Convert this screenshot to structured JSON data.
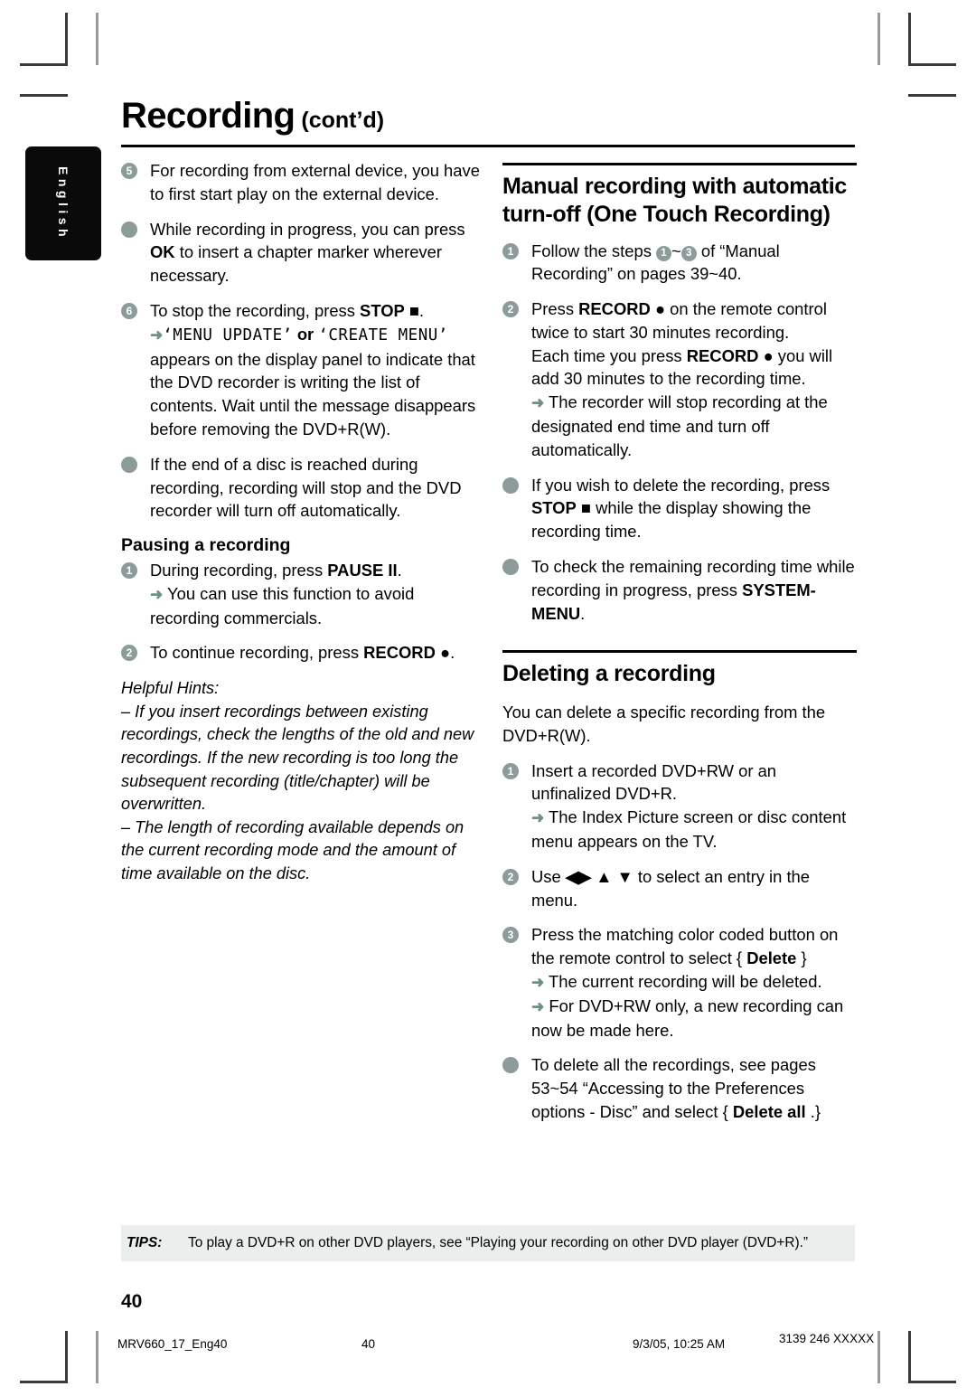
{
  "language_tab": {
    "label": "English"
  },
  "header": {
    "title": "Recording",
    "continued": "(cont’d)"
  },
  "left_column": {
    "items": [
      {
        "marker": "5",
        "marker_type": "number",
        "text": "For recording from external device, you have to first start play on the external device."
      },
      {
        "marker": "",
        "marker_type": "dot",
        "text_before": "While recording in progress, you can press ",
        "bold": "OK",
        "text_after": " to insert a chapter marker wherever necessary."
      },
      {
        "marker": "6",
        "marker_type": "number",
        "line1_before": "To stop the recording, press ",
        "line1_bold": "STOP",
        "line1_glyph": "■",
        "line1_after": ".",
        "arrow": "➜",
        "lcd_1": "‘MENU UPDATE’",
        "lcd_join": " or ",
        "lcd_2": "‘CREATE MENU’",
        "rest": "appears on the display panel to indicate that the DVD recorder is writing the list of contents. Wait until the message disappears before removing the DVD+R(W)."
      },
      {
        "marker": "",
        "marker_type": "dot",
        "text": "If the end of a disc is reached during recording, recording will stop and the DVD recorder will turn off automatically."
      }
    ],
    "pausing": {
      "heading": "Pausing a recording",
      "step1_before": "During recording, press ",
      "step1_bold": "PAUSE",
      "step1_glyph": "II",
      "step1_after": ".",
      "step1_arrow": "➜",
      "step1_arrow_text": "You can use this function to avoid recording commercials.",
      "step2_before": "To continue recording, press ",
      "step2_bold": "RECORD",
      "step2_glyph": "●",
      "step2_after": "."
    },
    "hints": {
      "title": "Helpful Hints:",
      "hint1": "–  If you insert recordings between existing recordings, check the lengths of the old and new recordings. If the new recording is too long the subsequent recording (title/chapter) will be overwritten.",
      "hint2": "–  The length of recording available depends on the current recording mode and the amount of time available on the disc."
    }
  },
  "right_column": {
    "section1": {
      "title": "Manual recording with automatic turn-off (One Touch Recording)",
      "step1": {
        "marker": "1",
        "before": "Follow the steps ",
        "ref_a": "1",
        "tilde": "~",
        "ref_b": "3",
        "after": " of “Manual Recording” on pages 39~40."
      },
      "step2": {
        "marker": "2",
        "l1_before": "Press ",
        "l1_bold": "RECORD",
        "l1_glyph": "●",
        "l1_after": " on the remote control twice to start 30 minutes recording.",
        "l2_before": "Each time you press ",
        "l2_bold": "RECORD",
        "l2_glyph": "●",
        "l2_after": " you will add 30 minutes to the recording time.",
        "arrow": "➜",
        "arrow_text": "The recorder will stop recording at the designated end time and turn off automatically."
      },
      "bullet1": {
        "before": "If you wish to delete the recording, press ",
        "bold": "STOP",
        "glyph": "■",
        "after": " while the display showing the recording time."
      },
      "bullet2": {
        "before": "To check the remaining recording time while recording in progress, press ",
        "bold": "SYSTEM-MENU",
        "after": "."
      }
    },
    "section2": {
      "title": "Deleting a recording",
      "intro": "You can delete a specific recording from the DVD+R(W).",
      "step1": {
        "marker": "1",
        "text": "Insert a recorded DVD+RW or an unfinalized DVD+R.",
        "arrow": "➜",
        "arrow_text": "The Index Picture screen or disc content menu appears on the TV."
      },
      "step2": {
        "marker": "2",
        "before": "Use ",
        "glyphs": "◀▶ ▲ ▼",
        "after": " to select an entry in the menu."
      },
      "step3": {
        "marker": "3",
        "before": "Press the matching color coded button on the remote control to select { ",
        "bold": "Delete",
        "after": " }",
        "arrow1": "➜",
        "arrow1_text": "The current recording will be deleted.",
        "arrow2": "➜",
        "arrow2_text": "For DVD+RW only, a new recording can now be made here."
      },
      "bullet1": {
        "before": "To delete all the recordings, see pages 53~54 “Accessing to the Preferences options - Disc” and select { ",
        "bold": "Delete all",
        "after": " .}"
      }
    }
  },
  "tips": {
    "label": "TIPS:",
    "text": "To play a DVD+R on other DVD players, see “Playing your recording on other DVD player (DVD+R).”"
  },
  "page_number": "40",
  "footer": {
    "file": "MRV660_17_Eng40",
    "page": "40",
    "date": "9/3/05, 10:25 AM",
    "code": "3139 246 XXXXX"
  },
  "colors": {
    "marker": "#8d9b9b",
    "arrow": "#6d8f8b",
    "tips_bg": "#eaeeec",
    "tab_bg": "#0a0a0a"
  }
}
